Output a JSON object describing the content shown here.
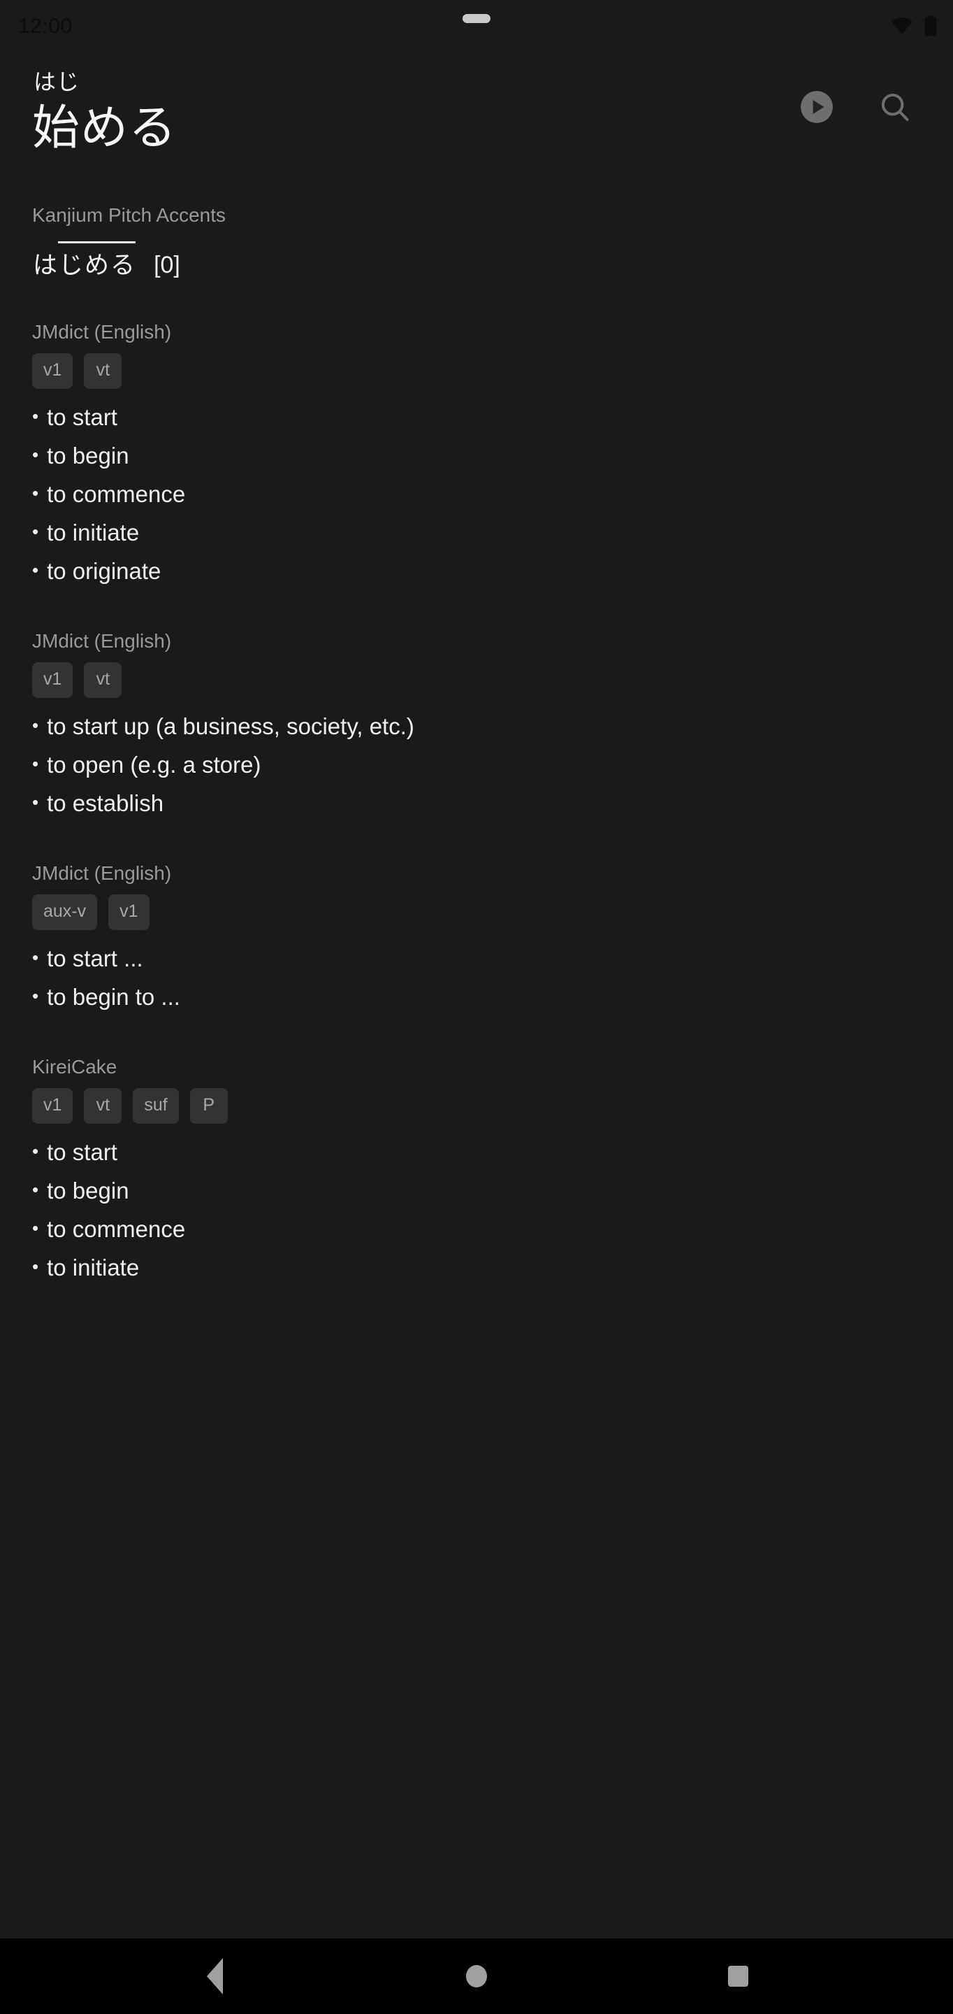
{
  "status_bar": {
    "clock": "12:00",
    "icons": [
      "wifi-icon",
      "battery-icon"
    ]
  },
  "app_bar": {
    "furigana": "はじ",
    "headword": "始める",
    "actions": [
      {
        "name": "play-audio-button",
        "icon": "play-circle-icon"
      },
      {
        "name": "search-button",
        "icon": "search-icon"
      }
    ]
  },
  "entries": [
    {
      "source": "Kanjium Pitch Accents",
      "type": "pitch",
      "pitch": {
        "moras": [
          {
            "text": "は",
            "high": false
          },
          {
            "text": "じ",
            "high": true
          },
          {
            "text": "め",
            "high": true
          },
          {
            "text": "る",
            "high": true
          }
        ],
        "number": "[0]"
      }
    },
    {
      "source": "JMdict (English)",
      "type": "definitions",
      "tags": [
        "v1",
        "vt"
      ],
      "definitions": [
        "to start",
        "to begin",
        "to commence",
        "to initiate",
        "to originate"
      ]
    },
    {
      "source": "JMdict (English)",
      "type": "definitions",
      "tags": [
        "v1",
        "vt"
      ],
      "definitions": [
        "to start up (a business, society, etc.)",
        "to open (e.g. a store)",
        "to establish"
      ]
    },
    {
      "source": "JMdict (English)",
      "type": "definitions",
      "tags": [
        "aux-v",
        "v1"
      ],
      "definitions": [
        "to start ...",
        "to begin to ..."
      ]
    },
    {
      "source": "KireiCake",
      "type": "definitions",
      "tags": [
        "v1",
        "vt",
        "suf",
        "P"
      ],
      "definitions": [
        "to start",
        "to begin",
        "to commence",
        "to initiate"
      ]
    }
  ],
  "nav_bar": {
    "buttons": [
      {
        "name": "nav-back-button",
        "icon": "triangle-back-icon"
      },
      {
        "name": "nav-home-button",
        "icon": "circle-home-icon"
      },
      {
        "name": "nav-recents-button",
        "icon": "square-recents-icon"
      }
    ]
  },
  "colors": {
    "background": "#1a1a1a",
    "nav_background": "#000000",
    "primary_text": "#efefef",
    "secondary_text": "#9a9a9a",
    "tag_background": "#333333",
    "icon": "#6e6e6e"
  }
}
